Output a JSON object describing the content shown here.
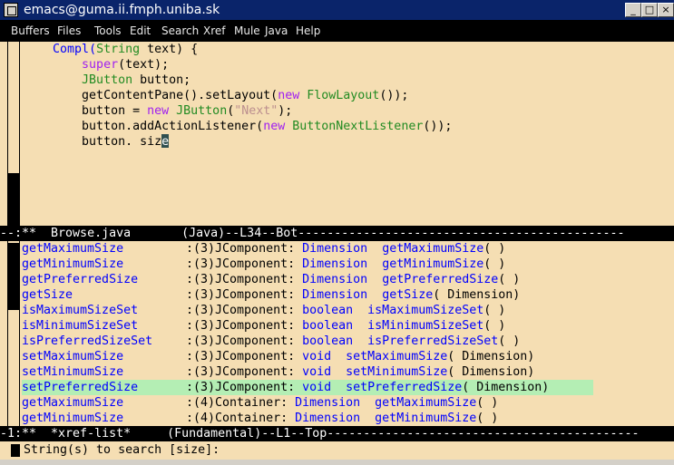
{
  "window": {
    "title": "emacs@guma.ii.fmph.uniba.sk",
    "controls": [
      "_",
      "□",
      "×"
    ]
  },
  "menubar": [
    "Buffers",
    "Files",
    "Tools",
    "Edit",
    "Search",
    "Xref",
    "Mule",
    "Java",
    "Help"
  ],
  "code": {
    "line1": {
      "indent": "    ",
      "a": "Compl",
      "b": "(",
      "c": "String",
      "d": " text) {"
    },
    "line2": {
      "indent": "        ",
      "a": "super",
      "b": "(text);"
    },
    "line3": {
      "indent": "        ",
      "a": "JButton",
      "b": " button;"
    },
    "line4": {
      "indent": "        ",
      "a": "getContentPane().setLayout(",
      "b": "new",
      "c": " ",
      "d": "FlowLayout",
      "e": "());"
    },
    "line5": {
      "indent": "        ",
      "a": "button = ",
      "b": "new",
      "c": " ",
      "d": "JButton",
      "e": "(",
      "f": "\"Next\"",
      "g": ");"
    },
    "line6": {
      "indent": "        ",
      "a": "button.addActionListener(",
      "b": "new",
      "c": " ",
      "d": "ButtonNextListener",
      "e": "());"
    },
    "line7": {
      "indent": "        ",
      "a": "button. siz",
      "cursor": "e"
    }
  },
  "modeline_top": "--:**  Browse.java       (Java)--L34--Bot---------------------------------------------",
  "xref_rows": [
    {
      "name": "getMaximumSize",
      "level": ":(3)",
      "cls": "JComponent: ",
      "type": "Dimension",
      "sig": "getMaximumSize",
      "args": "( )"
    },
    {
      "name": "getMinimumSize",
      "level": ":(3)",
      "cls": "JComponent: ",
      "type": "Dimension",
      "sig": "getMinimumSize",
      "args": "( )"
    },
    {
      "name": "getPreferredSize",
      "level": ":(3)",
      "cls": "JComponent: ",
      "type": "Dimension",
      "sig": "getPreferredSize",
      "args": "( )"
    },
    {
      "name": "getSize",
      "level": ":(3)",
      "cls": "JComponent: ",
      "type": "Dimension",
      "sig": "getSize",
      "args": "( Dimension)"
    },
    {
      "name": "isMaximumSizeSet",
      "level": ":(3)",
      "cls": "JComponent: ",
      "type": "boolean",
      "sig": "isMaximumSizeSet",
      "args": "( )"
    },
    {
      "name": "isMinimumSizeSet",
      "level": ":(3)",
      "cls": "JComponent: ",
      "type": "boolean",
      "sig": "isMinimumSizeSet",
      "args": "( )"
    },
    {
      "name": "isPreferredSizeSet",
      "level": ":(3)",
      "cls": "JComponent: ",
      "type": "boolean",
      "sig": "isPreferredSizeSet",
      "args": "( )"
    },
    {
      "name": "setMaximumSize",
      "level": ":(3)",
      "cls": "JComponent: ",
      "type": "void",
      "sig": "setMaximumSize",
      "args": "( Dimension)"
    },
    {
      "name": "setMinimumSize",
      "level": ":(3)",
      "cls": "JComponent: ",
      "type": "void",
      "sig": "setMinimumSize",
      "args": "( Dimension)"
    },
    {
      "name": "setPreferredSize",
      "level": ":(3)",
      "cls": "JComponent: ",
      "type": "void",
      "sig": "setPreferredSize",
      "args": "( Dimension)"
    },
    {
      "name": "getMaximumSize",
      "level": ":(4)",
      "cls": "Container: ",
      "type": "Dimension",
      "sig": "getMaximumSize",
      "args": "( )"
    },
    {
      "name": "getMinimumSize",
      "level": ":(4)",
      "cls": "Container: ",
      "type": "Dimension",
      "sig": "getMinimumSize",
      "args": "( )"
    }
  ],
  "highlighted_row_index": 9,
  "modeline_bottom": "-1:**  *xref-list*     (Fundamental)--L1--Top-------------------------------------------",
  "minibuffer": "String(s) to search [size]:",
  "colors": {
    "background": "#f5deb3",
    "keyword": "#a020f0",
    "type": "#228b22",
    "function": "#0000ff",
    "string": "#bc8f8f",
    "highlight": "#b4eeb4",
    "titlebar": "#0a246a"
  }
}
